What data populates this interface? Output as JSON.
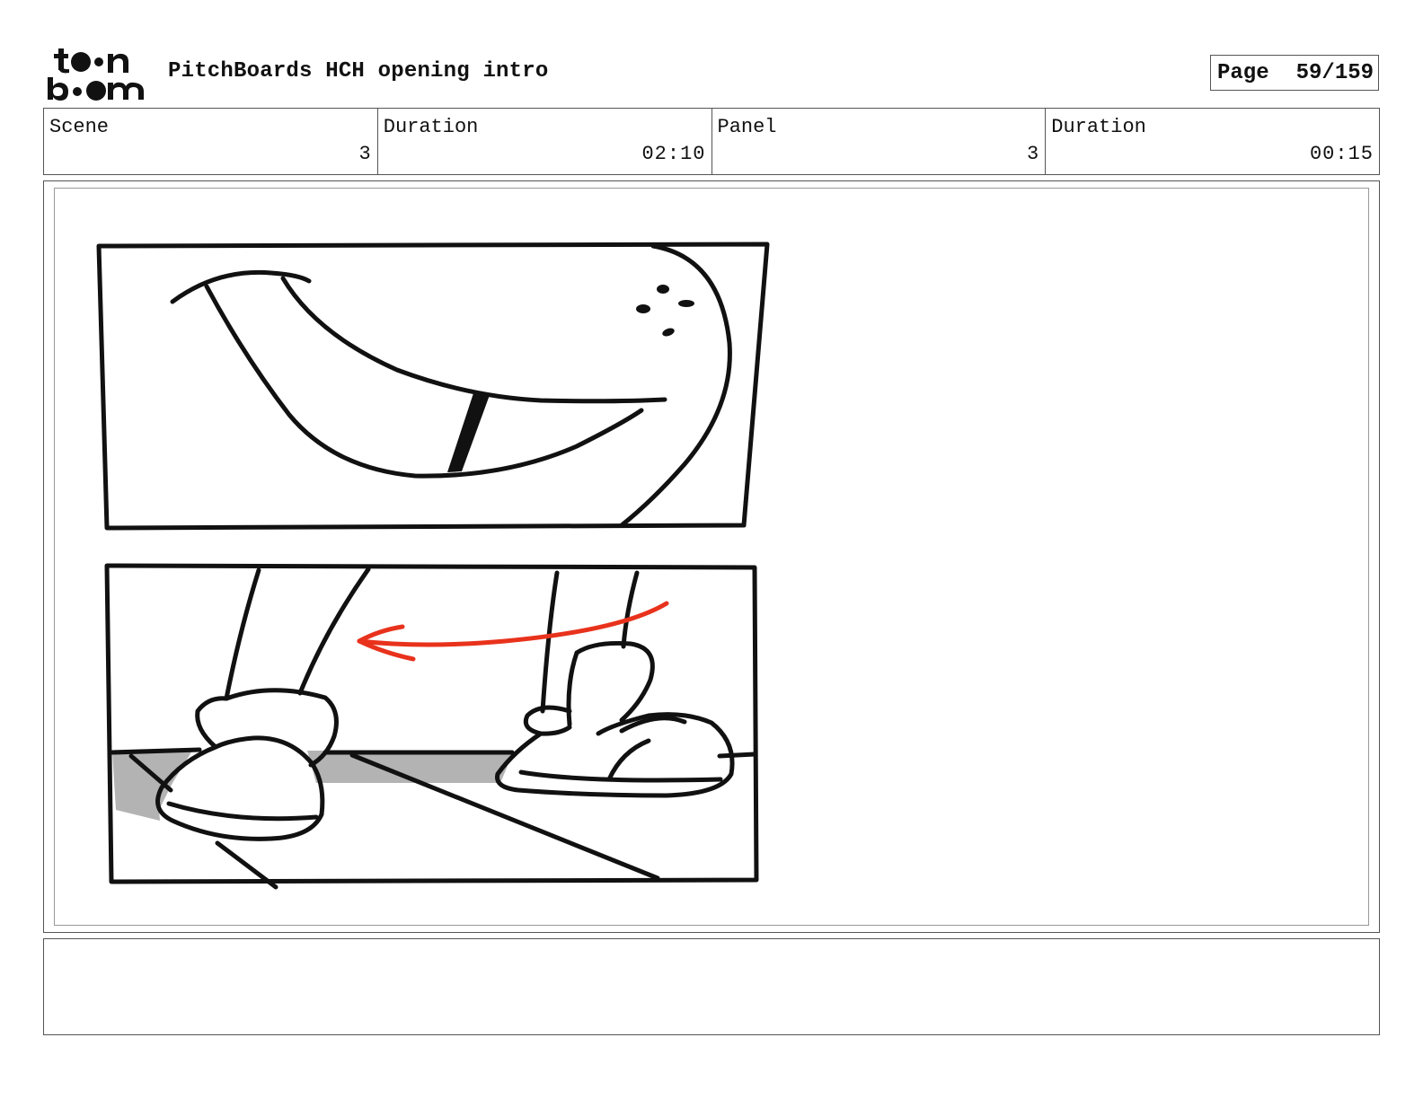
{
  "header": {
    "logo_text_top": "toon",
    "logo_text_bottom": "boom",
    "title": "PitchBoards HCH opening intro",
    "page_label": "Page",
    "page_value": "59/159"
  },
  "info": {
    "scene_label": "Scene",
    "scene_value": "3",
    "scene_duration_label": "Duration",
    "scene_duration_value": "02:10",
    "panel_label": "Panel",
    "panel_value": "3",
    "panel_duration_label": "Duration",
    "panel_duration_value": "00:15"
  },
  "panel": {
    "image_icon": "storyboard-sketch",
    "arrow_color": "#e8321c",
    "shadow_color": "#b3b3b3"
  },
  "notes": {
    "text": ""
  }
}
